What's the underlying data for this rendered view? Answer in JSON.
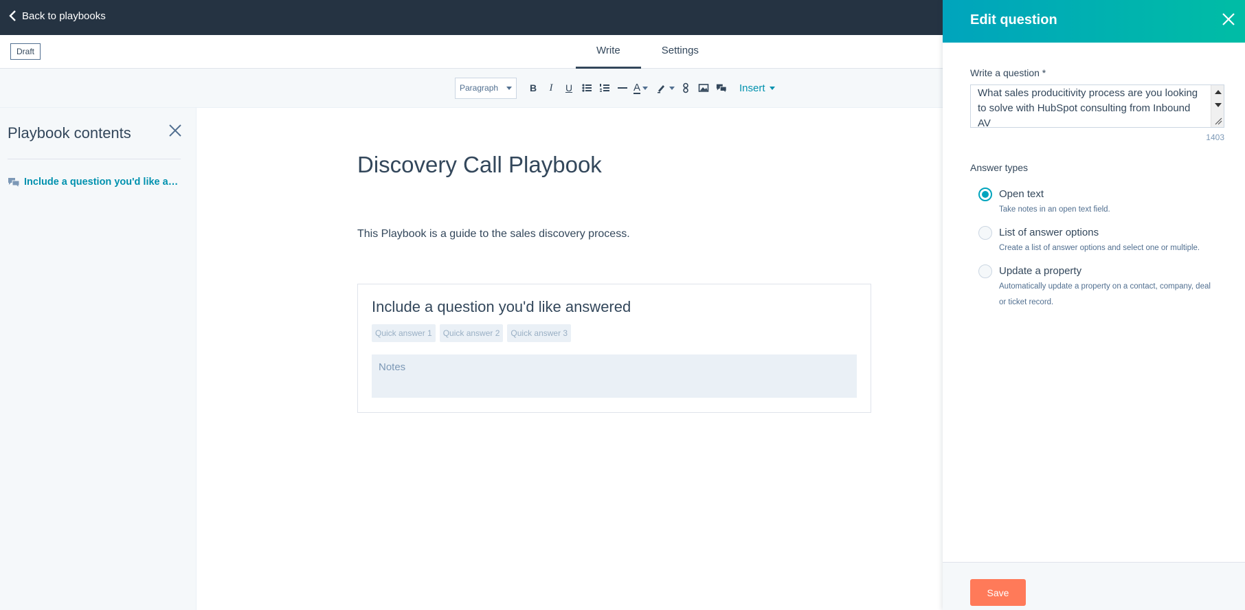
{
  "topbar": {
    "back_label": "Back to playbooks"
  },
  "subbar": {
    "status_badge": "Draft",
    "tabs": [
      {
        "label": "Write"
      },
      {
        "label": "Settings"
      }
    ]
  },
  "toolbar": {
    "paragraph_style": "Paragraph",
    "insert_label": "Insert",
    "text_color": "#33475b"
  },
  "sidebar": {
    "title": "Playbook contents",
    "items": [
      {
        "label": "Include a question you'd like answered"
      }
    ]
  },
  "document": {
    "title": "Discovery Call Playbook",
    "description": "This Playbook is a guide to the sales discovery process.",
    "question": {
      "title": "Include a question you'd like answered",
      "quick_answers": [
        "Quick answer 1",
        "Quick answer 2",
        "Quick answer 3"
      ],
      "notes_placeholder": "Notes"
    }
  },
  "panel": {
    "title": "Edit question",
    "question_label": "Write a question *",
    "question_value": "What sales producitivity process are you looking to solve with HubSpot consulting from Inbound AV",
    "char_count": "1403",
    "answer_types_label": "Answer types",
    "answer_types": [
      {
        "title": "Open text",
        "description": "Take notes in an open text field.",
        "selected": true
      },
      {
        "title": "List of answer options",
        "description": "Create a list of answer options and select one or multiple.",
        "selected": false
      },
      {
        "title": "Update a property",
        "description": "Automatically update a property on a contact, company, deal or ticket record.",
        "selected": false
      }
    ],
    "save_label": "Save"
  },
  "colors": {
    "accent": "#00a4bd",
    "primary_action": "#ff7a59",
    "nav_bg": "#253342",
    "link": "#0091ae"
  }
}
